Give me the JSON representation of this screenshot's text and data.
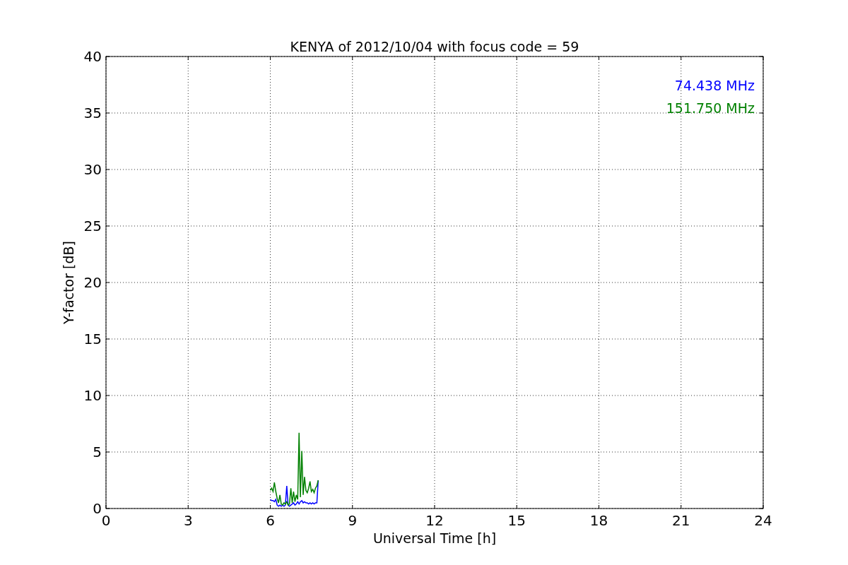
{
  "figure": {
    "chart_data": {
      "type": "line",
      "title": "KENYA of 2012/10/04 with focus code = 59",
      "xlabel": "Universal Time [h]",
      "ylabel": "Y-factor [dB]",
      "x": [
        6.0,
        6.05,
        6.1,
        6.15,
        6.2,
        6.25,
        6.3,
        6.35,
        6.4,
        6.45,
        6.5,
        6.55,
        6.6,
        6.65,
        6.7,
        6.75,
        6.8,
        6.85,
        6.9,
        6.95,
        7.0,
        7.05,
        7.1,
        7.15,
        7.2,
        7.25,
        7.3,
        7.35,
        7.4,
        7.45,
        7.5,
        7.55,
        7.6,
        7.65,
        7.7,
        7.75
      ],
      "series": [
        {
          "name": "74.438 MHz",
          "color": "#0000ff",
          "values": [
            0.8,
            0.7,
            0.7,
            0.6,
            0.8,
            0.3,
            0.2,
            0.3,
            0.2,
            0.3,
            0.2,
            0.3,
            2.0,
            0.3,
            0.2,
            0.3,
            0.4,
            0.5,
            0.3,
            0.4,
            0.6,
            0.4,
            0.6,
            0.7,
            0.5,
            0.6,
            0.5,
            0.5,
            0.4,
            0.5,
            0.4,
            0.5,
            0.4,
            0.5,
            0.5,
            2.5
          ]
        },
        {
          "name": "151.750 MHz",
          "color": "#008000",
          "values": [
            1.6,
            1.8,
            1.5,
            2.3,
            1.5,
            0.9,
            0.5,
            1.2,
            0.4,
            0.3,
            0.5,
            0.4,
            0.6,
            0.3,
            0.4,
            1.8,
            0.5,
            1.5,
            0.6,
            1.2,
            0.8,
            6.7,
            1.0,
            5.1,
            1.2,
            2.8,
            1.6,
            1.4,
            1.8,
            2.4,
            1.5,
            1.7,
            1.4,
            1.8,
            2.0,
            2.5
          ]
        }
      ],
      "grid": true,
      "xlim": [
        0,
        24
      ],
      "ylim": [
        0,
        40
      ],
      "xticks": [
        0,
        3,
        6,
        9,
        12,
        15,
        18,
        21,
        24
      ],
      "yticks": [
        0,
        5,
        10,
        15,
        20,
        25,
        30,
        35,
        40
      ]
    }
  }
}
